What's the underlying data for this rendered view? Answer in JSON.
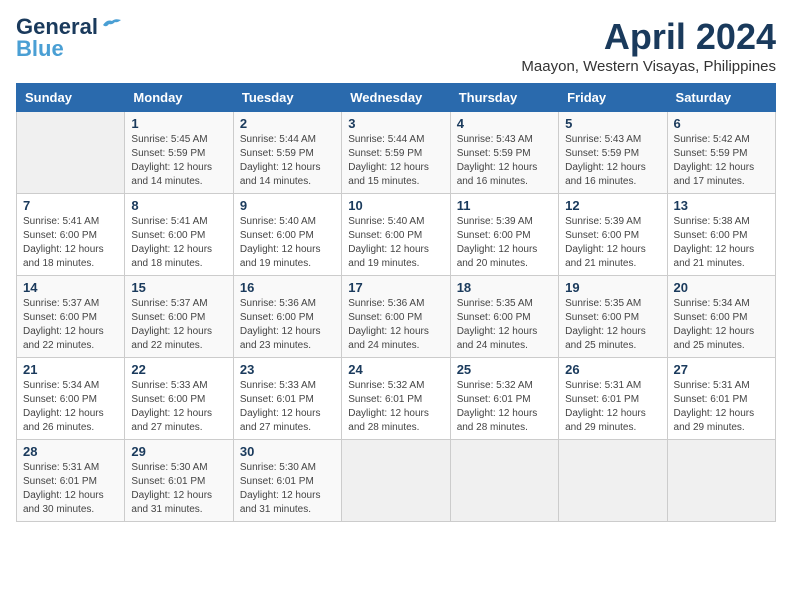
{
  "header": {
    "logo_line1": "General",
    "logo_line2": "Blue",
    "month": "April 2024",
    "location": "Maayon, Western Visayas, Philippines"
  },
  "weekdays": [
    "Sunday",
    "Monday",
    "Tuesday",
    "Wednesday",
    "Thursday",
    "Friday",
    "Saturday"
  ],
  "weeks": [
    [
      {
        "day": "",
        "info": ""
      },
      {
        "day": "1",
        "info": "Sunrise: 5:45 AM\nSunset: 5:59 PM\nDaylight: 12 hours\nand 14 minutes."
      },
      {
        "day": "2",
        "info": "Sunrise: 5:44 AM\nSunset: 5:59 PM\nDaylight: 12 hours\nand 14 minutes."
      },
      {
        "day": "3",
        "info": "Sunrise: 5:44 AM\nSunset: 5:59 PM\nDaylight: 12 hours\nand 15 minutes."
      },
      {
        "day": "4",
        "info": "Sunrise: 5:43 AM\nSunset: 5:59 PM\nDaylight: 12 hours\nand 16 minutes."
      },
      {
        "day": "5",
        "info": "Sunrise: 5:43 AM\nSunset: 5:59 PM\nDaylight: 12 hours\nand 16 minutes."
      },
      {
        "day": "6",
        "info": "Sunrise: 5:42 AM\nSunset: 5:59 PM\nDaylight: 12 hours\nand 17 minutes."
      }
    ],
    [
      {
        "day": "7",
        "info": "Sunrise: 5:41 AM\nSunset: 6:00 PM\nDaylight: 12 hours\nand 18 minutes."
      },
      {
        "day": "8",
        "info": "Sunrise: 5:41 AM\nSunset: 6:00 PM\nDaylight: 12 hours\nand 18 minutes."
      },
      {
        "day": "9",
        "info": "Sunrise: 5:40 AM\nSunset: 6:00 PM\nDaylight: 12 hours\nand 19 minutes."
      },
      {
        "day": "10",
        "info": "Sunrise: 5:40 AM\nSunset: 6:00 PM\nDaylight: 12 hours\nand 19 minutes."
      },
      {
        "day": "11",
        "info": "Sunrise: 5:39 AM\nSunset: 6:00 PM\nDaylight: 12 hours\nand 20 minutes."
      },
      {
        "day": "12",
        "info": "Sunrise: 5:39 AM\nSunset: 6:00 PM\nDaylight: 12 hours\nand 21 minutes."
      },
      {
        "day": "13",
        "info": "Sunrise: 5:38 AM\nSunset: 6:00 PM\nDaylight: 12 hours\nand 21 minutes."
      }
    ],
    [
      {
        "day": "14",
        "info": "Sunrise: 5:37 AM\nSunset: 6:00 PM\nDaylight: 12 hours\nand 22 minutes."
      },
      {
        "day": "15",
        "info": "Sunrise: 5:37 AM\nSunset: 6:00 PM\nDaylight: 12 hours\nand 22 minutes."
      },
      {
        "day": "16",
        "info": "Sunrise: 5:36 AM\nSunset: 6:00 PM\nDaylight: 12 hours\nand 23 minutes."
      },
      {
        "day": "17",
        "info": "Sunrise: 5:36 AM\nSunset: 6:00 PM\nDaylight: 12 hours\nand 24 minutes."
      },
      {
        "day": "18",
        "info": "Sunrise: 5:35 AM\nSunset: 6:00 PM\nDaylight: 12 hours\nand 24 minutes."
      },
      {
        "day": "19",
        "info": "Sunrise: 5:35 AM\nSunset: 6:00 PM\nDaylight: 12 hours\nand 25 minutes."
      },
      {
        "day": "20",
        "info": "Sunrise: 5:34 AM\nSunset: 6:00 PM\nDaylight: 12 hours\nand 25 minutes."
      }
    ],
    [
      {
        "day": "21",
        "info": "Sunrise: 5:34 AM\nSunset: 6:00 PM\nDaylight: 12 hours\nand 26 minutes."
      },
      {
        "day": "22",
        "info": "Sunrise: 5:33 AM\nSunset: 6:00 PM\nDaylight: 12 hours\nand 27 minutes."
      },
      {
        "day": "23",
        "info": "Sunrise: 5:33 AM\nSunset: 6:01 PM\nDaylight: 12 hours\nand 27 minutes."
      },
      {
        "day": "24",
        "info": "Sunrise: 5:32 AM\nSunset: 6:01 PM\nDaylight: 12 hours\nand 28 minutes."
      },
      {
        "day": "25",
        "info": "Sunrise: 5:32 AM\nSunset: 6:01 PM\nDaylight: 12 hours\nand 28 minutes."
      },
      {
        "day": "26",
        "info": "Sunrise: 5:31 AM\nSunset: 6:01 PM\nDaylight: 12 hours\nand 29 minutes."
      },
      {
        "day": "27",
        "info": "Sunrise: 5:31 AM\nSunset: 6:01 PM\nDaylight: 12 hours\nand 29 minutes."
      }
    ],
    [
      {
        "day": "28",
        "info": "Sunrise: 5:31 AM\nSunset: 6:01 PM\nDaylight: 12 hours\nand 30 minutes."
      },
      {
        "day": "29",
        "info": "Sunrise: 5:30 AM\nSunset: 6:01 PM\nDaylight: 12 hours\nand 31 minutes."
      },
      {
        "day": "30",
        "info": "Sunrise: 5:30 AM\nSunset: 6:01 PM\nDaylight: 12 hours\nand 31 minutes."
      },
      {
        "day": "",
        "info": ""
      },
      {
        "day": "",
        "info": ""
      },
      {
        "day": "",
        "info": ""
      },
      {
        "day": "",
        "info": ""
      }
    ]
  ]
}
